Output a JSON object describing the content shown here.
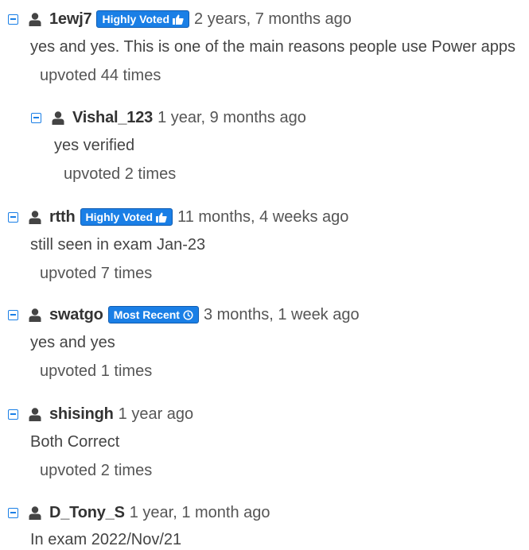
{
  "comments": [
    {
      "username": "1ewj7",
      "badge": "Highly Voted",
      "date": "2 years, 7 months ago",
      "text": "yes and yes. This is one of the main reasons people use Power apps",
      "votes": "upvoted 44 times"
    },
    {
      "username": "Vishal_123",
      "date": "1 year, 9 months ago",
      "text": "yes verified",
      "votes": "upvoted 2 times"
    },
    {
      "username": "rtth",
      "badge": "Highly Voted",
      "date": "11 months, 4 weeks ago",
      "text": "still seen in exam Jan-23",
      "votes": "upvoted 7 times"
    },
    {
      "username": "swatgo",
      "badge": "Most Recent",
      "date": "3 months, 1 week ago",
      "text": "yes and yes",
      "votes": "upvoted 1 times"
    },
    {
      "username": "shisingh",
      "date": "1 year ago",
      "text": "Both Correct",
      "votes": "upvoted 2 times"
    },
    {
      "username": "D_Tony_S",
      "date": "1 year, 1 month ago",
      "text": "In exam 2022/Nov/21"
    }
  ],
  "colors": {
    "accent": "#1a7fe6",
    "text": "#444444"
  }
}
